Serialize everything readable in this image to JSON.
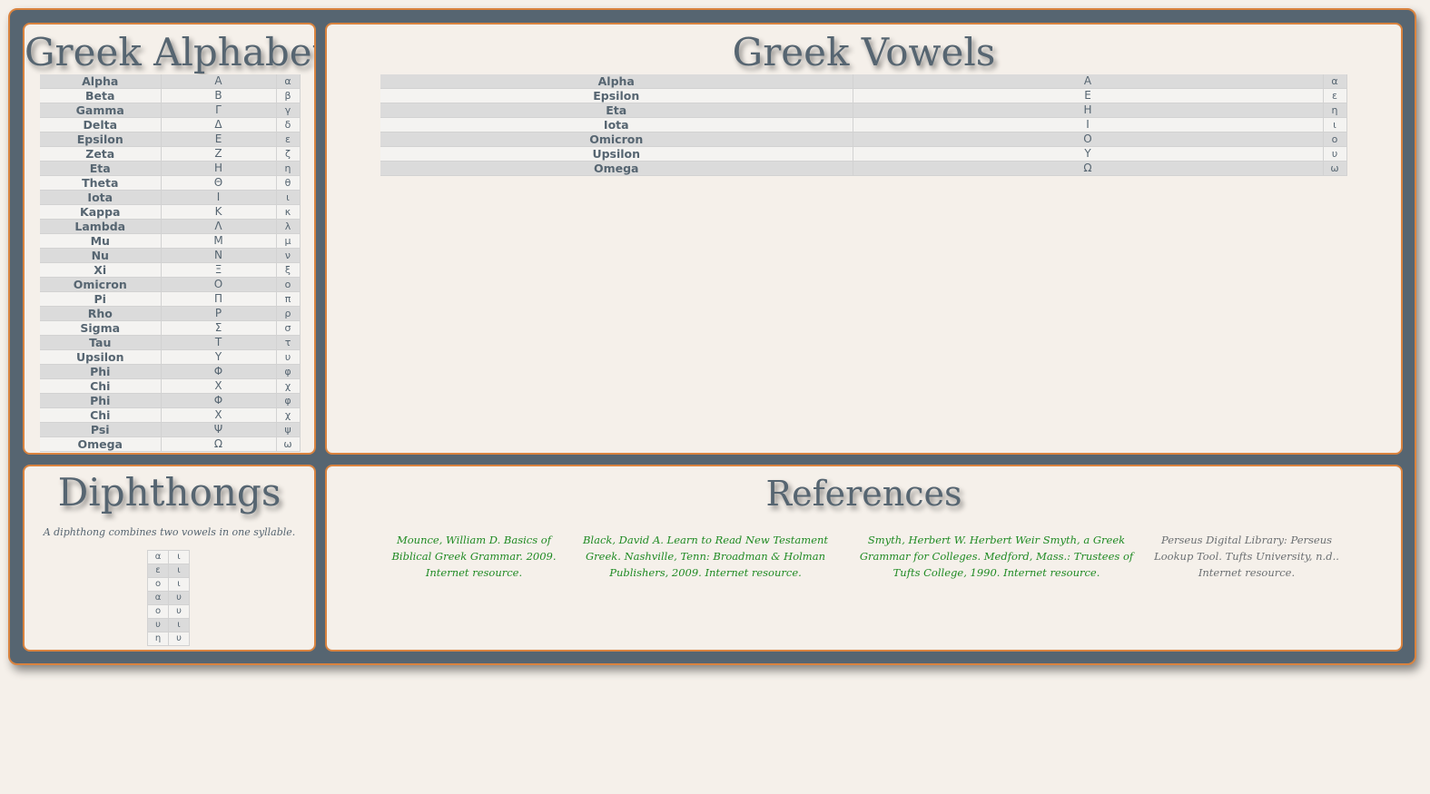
{
  "alphabet": {
    "title": "Greek Alphabet",
    "rows": [
      [
        "Alpha",
        "Α",
        "α"
      ],
      [
        "Beta",
        "Β",
        "β"
      ],
      [
        "Gamma",
        "Γ",
        "γ"
      ],
      [
        "Delta",
        "Δ",
        "δ"
      ],
      [
        "Epsilon",
        "Ε",
        "ε"
      ],
      [
        "Zeta",
        "Ζ",
        "ζ"
      ],
      [
        "Eta",
        "Η",
        "η"
      ],
      [
        "Theta",
        "Θ",
        "θ"
      ],
      [
        "Iota",
        "Ι",
        "ι"
      ],
      [
        "Kappa",
        "Κ",
        "κ"
      ],
      [
        "Lambda",
        "Λ",
        "λ"
      ],
      [
        "Mu",
        "Μ",
        "μ"
      ],
      [
        "Nu",
        "Ν",
        "ν"
      ],
      [
        "Xi",
        "Ξ",
        "ξ"
      ],
      [
        "Omicron",
        "Ο",
        "ο"
      ],
      [
        "Pi",
        "Π",
        "π"
      ],
      [
        "Rho",
        "Ρ",
        "ρ"
      ],
      [
        "Sigma",
        "Σ",
        "σ"
      ],
      [
        "Tau",
        "Τ",
        "τ"
      ],
      [
        "Upsilon",
        "Υ",
        "υ"
      ],
      [
        "Phi",
        "Φ",
        "φ"
      ],
      [
        "Chi",
        "Χ",
        "χ"
      ],
      [
        "Phi",
        "Φ",
        "φ"
      ],
      [
        "Chi",
        "Χ",
        "χ"
      ],
      [
        "Psi",
        "Ψ",
        "ψ"
      ],
      [
        "Omega",
        "Ω",
        "ω"
      ]
    ]
  },
  "vowels": {
    "title": "Greek Vowels",
    "rows": [
      [
        "Alpha",
        "Α",
        "α"
      ],
      [
        "Epsilon",
        "Ε",
        "ε"
      ],
      [
        "Eta",
        "Η",
        "η"
      ],
      [
        "Iota",
        "Ι",
        "ι"
      ],
      [
        "Omicron",
        "Ο",
        "ο"
      ],
      [
        "Upsilon",
        "Υ",
        "υ"
      ],
      [
        "Omega",
        "Ω",
        "ω"
      ]
    ]
  },
  "diphthongs": {
    "title": "Diphthongs",
    "note": "A diphthong combines two vowels in one syllable.",
    "rows": [
      [
        "α",
        "ι"
      ],
      [
        "ε",
        "ι"
      ],
      [
        "ο",
        "ι"
      ],
      [
        "α",
        "υ"
      ],
      [
        "ο",
        "υ"
      ],
      [
        "υ",
        "ι"
      ],
      [
        "η",
        "υ"
      ]
    ]
  },
  "references": {
    "title": "References",
    "items": [
      {
        "text": "Mounce, William D. Basics of Biblical Greek Grammar. 2009. Internet resource.",
        "link": true
      },
      {
        "text": "Black, David A. Learn to Read New Testament Greek. Nashville, Tenn: Broadman & Holman Publishers, 2009. Internet resource.",
        "link": true
      },
      {
        "text": "Smyth, Herbert W. Herbert Weir Smyth, a Greek Grammar for Colleges. Medford, Mass.: Trustees of Tufts College, 1990. Internet resource.",
        "link": true
      },
      {
        "text": "Perseus Digital Library: Perseus Lookup Tool. Tufts University, n.d.. Internet resource.",
        "link": false
      }
    ]
  },
  "colors": {
    "frame": "#566571",
    "border": "#d9833f",
    "background": "#f5f0ea",
    "link": "#1f8a23",
    "row_shade": "#dbdbdb"
  }
}
